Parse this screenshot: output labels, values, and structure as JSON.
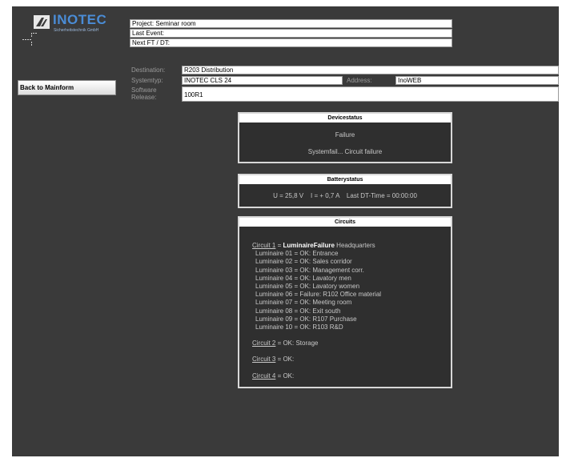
{
  "logo": {
    "brand": "INOTEC",
    "subtitle": "Sicherheitstechnik GmbH"
  },
  "header": {
    "project": "Project:  Seminar room",
    "last_event": "Last Event:",
    "next_ft": "Next FT / DT:"
  },
  "nav": {
    "back_label": "Back to Mainform"
  },
  "info": {
    "destination_label": "Destination:",
    "destination_value": "R203 Distribution",
    "systemtyp_label": "Systemtyp:",
    "systemtyp_value": "INOTEC CLS 24",
    "address_label": "Address:",
    "address_value": "InoWEB",
    "software_label_1": "Software",
    "software_label_2": "Release:",
    "software_value": "100R1"
  },
  "devicestatus": {
    "title": "Devicestatus",
    "status": "Failure",
    "detail": "Systemfail... Circuit failure"
  },
  "batterystatus": {
    "title": "Batterystatus",
    "values": "U = 25,8 V    I = + 0,7 A    Last DT-Time = 00:00:00"
  },
  "circuits": {
    "title": "Circuits",
    "c1_link": "Circuit 1",
    "c1_eq": " = ",
    "c1_status": "LuminaireFailure",
    "c1_rest": " Headquarters",
    "luminaires": [
      "Luminaire 01 = OK: Entrance",
      "Luminaire 02 = OK: Sales corridor",
      "Luminaire 03 = OK: Management corr.",
      "Luminaire 04 = OK: Lavatory men",
      "Luminaire 05 = OK: Lavatory women",
      "Luminaire 06 = Failure: R102 Office material",
      "Luminaire 07 = OK: Meeting room",
      "Luminaire 08 = OK: Exit south",
      "Luminaire 09 = OK: R107 Purchase",
      "Luminaire 10 = OK: R103 R&D"
    ],
    "c2_link": "Circuit 2",
    "c2_rest": " = OK: Storage",
    "c3_link": "Circuit 3",
    "c3_rest": " = OK:",
    "c4_link": "Circuit 4",
    "c4_rest": " = OK:"
  },
  "colors": {
    "background": "#3a3a3a",
    "brand_blue": "#4a8cd6",
    "panel_border": "#d8d8d8"
  }
}
